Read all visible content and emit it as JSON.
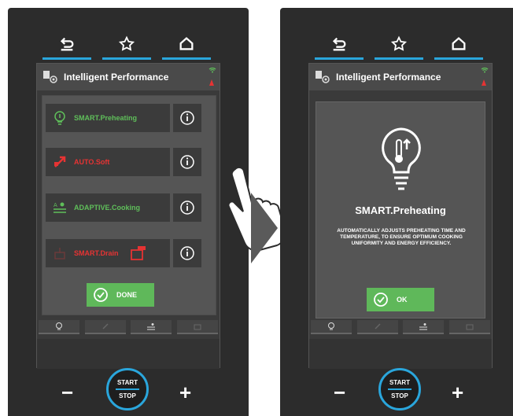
{
  "nav": {
    "back_icon": "back-arrow-icon",
    "favorite_icon": "star-icon",
    "home_icon": "home-icon"
  },
  "header": {
    "title": "Intelligent Performance"
  },
  "features": [
    {
      "label": "SMART.Preheating",
      "color": "#5fbf5a",
      "icon": "bulb-thermometer-icon"
    },
    {
      "label": "AUTO.Soft",
      "color": "#e63333",
      "icon": "auto-soft-icon"
    },
    {
      "label": "ADAPTIVE.Cooking",
      "color": "#5fbf5a",
      "icon": "adaptive-cooking-icon"
    },
    {
      "label": "SMART.Drain",
      "color": "#e63333",
      "icon": "smart-drain-icon"
    }
  ],
  "done_button": {
    "label": "DONE"
  },
  "popup": {
    "title": "SMART.Preheating",
    "description": "AUTOMATICALLY ADJUSTS PREHEATING TIME AND TEMPERATURE, TO ENSURE OPTIMUM COOKING UNIFORMITY AND ENERGY EFFICIENCY.",
    "ok_label": "OK"
  },
  "controls": {
    "minus": "−",
    "plus": "+",
    "start": "START",
    "stop": "STOP"
  },
  "colors": {
    "accent": "#2aa6dc",
    "green": "#5fb85a",
    "red": "#e63333"
  }
}
